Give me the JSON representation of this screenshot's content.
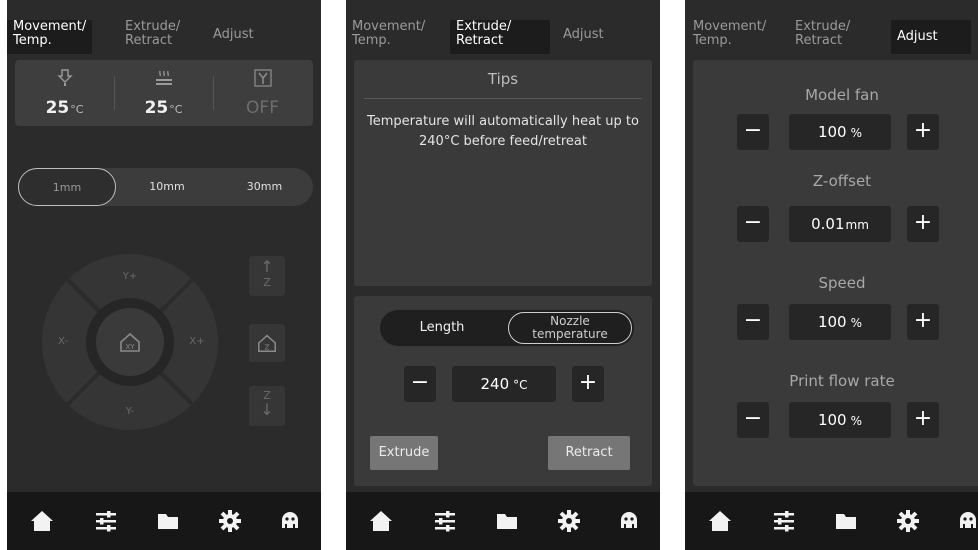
{
  "screens": {
    "movement": {
      "tabs": [
        "Movement/\nTemp.",
        "Extrude/\nRetract",
        "Adjust"
      ],
      "temps": [
        {
          "icon": "nozzle-icon",
          "value": "25",
          "unit": "°C"
        },
        {
          "icon": "heated-bed-icon",
          "value": "25",
          "unit": "°C"
        },
        {
          "icon": "fan-icon",
          "value": "OFF",
          "unit": ""
        }
      ],
      "steps": [
        "1mm",
        "10mm",
        "30mm"
      ],
      "selected_step": "1mm",
      "jog": {
        "y_plus": "Y+",
        "y_minus": "Y-",
        "x_plus": "X+",
        "x_minus": "X-",
        "z_up": "Z",
        "z_down": "Z"
      }
    },
    "extrude": {
      "tabs": [
        "Movement/\nTemp.",
        "Extrude/\nRetract",
        "Adjust"
      ],
      "tips_title": "Tips",
      "tips_text": "Temperature will automatically heat up to 240°C before feed/retreat",
      "segment_left": "Length",
      "segment_right": "Nozzle\ntemperature",
      "stepper_value": "240",
      "stepper_unit": "°C",
      "extrude_label": "Extrude",
      "retract_label": "Retract"
    },
    "adjust": {
      "tabs": [
        "Movement/\nTemp.",
        "Extrude/\nRetract",
        "Adjust"
      ],
      "rows": [
        {
          "label": "Model fan",
          "value": "100",
          "unit": "%"
        },
        {
          "label": "Z-offset",
          "value": "0.01",
          "unit": "mm"
        },
        {
          "label": "Speed",
          "value": "100",
          "unit": "%"
        },
        {
          "label": "Print flow rate",
          "value": "100",
          "unit": "%"
        }
      ]
    }
  },
  "controls": {
    "minus": "−",
    "plus": "+"
  },
  "nav_icons": [
    "home-icon",
    "sliders-icon",
    "folder-icon",
    "gear-icon",
    "robot-icon"
  ],
  "colors": {
    "screen_bg": "#2b2b2b",
    "card_bg": "#3a3a3a",
    "nav_bg": "#171717",
    "button_gray": "#767676"
  }
}
